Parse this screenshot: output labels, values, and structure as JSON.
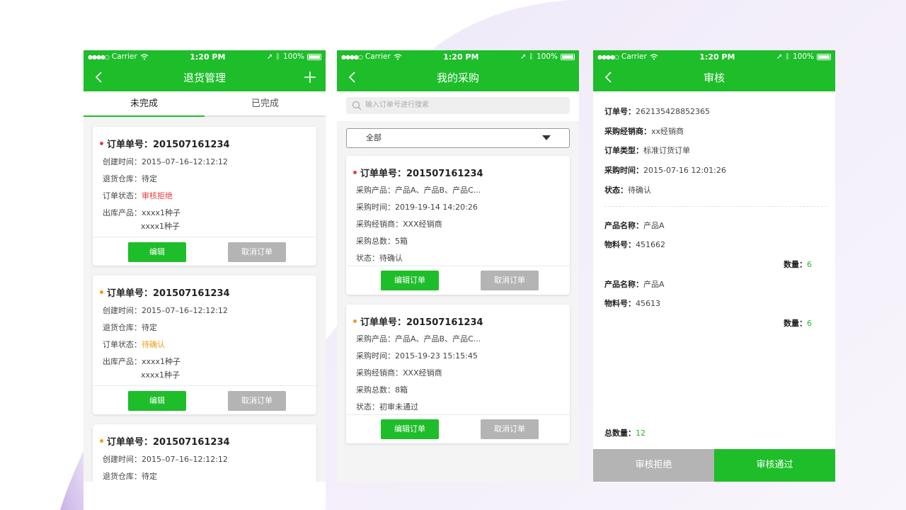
{
  "statusbar": {
    "carrier": "Carrier",
    "time": "1:20 PM",
    "battery": "100%"
  },
  "screen1": {
    "title": "退货管理",
    "tabs": [
      "未完成",
      "已完成"
    ],
    "cards": [
      {
        "dot_color": "#e84040",
        "order_label": "订单单号：",
        "order_no": "201507161234",
        "created_label": "创建时间：",
        "created": "2015–07–16–12:12:12",
        "warehouse_label": "退货仓库：",
        "warehouse": "待定",
        "status_label": "订单状态：",
        "status": "审核拒绝",
        "status_color": "red",
        "products_label": "出库产品：",
        "products": [
          "xxxx1种子",
          "xxxx1种子"
        ],
        "edit": "编辑",
        "cancel": "取消订单"
      },
      {
        "dot_color": "#f59a12",
        "order_label": "订单单号：",
        "order_no": "201507161234",
        "created_label": "创建时间：",
        "created": "2015–07–16–12:12:12",
        "warehouse_label": "退货仓库：",
        "warehouse": "待定",
        "status_label": "订单状态：",
        "status": "待确认",
        "status_color": "orange",
        "products_label": "出库产品：",
        "products": [
          "xxxx1种子",
          "xxxx1种子"
        ],
        "edit": "编辑",
        "cancel": "取消订单"
      },
      {
        "dot_color": "#f59a12",
        "order_label": "订单单号：",
        "order_no": "201507161234",
        "created_label": "创建时间：",
        "created": "2015–07–16–12:12:12",
        "warehouse_label": "退货仓库：",
        "warehouse": "待定"
      }
    ]
  },
  "screen2": {
    "title": "我的采购",
    "search_placeholder": "输入订单号进行搜索",
    "filter": "全部",
    "cards": [
      {
        "dot_color": "#e84040",
        "order_label": "订单单号：",
        "order_no": "201507161234",
        "products": "采购产品：产品A、产品B、产品C...",
        "time": "采购时间：2019-19-14 14:20:26",
        "dealer": "采购经销商：XXX经销商",
        "total": "采购总数：5箱",
        "status": "状态：待确认",
        "edit": "编辑订单",
        "cancel": "取消订单"
      },
      {
        "dot_color": "#f59a12",
        "order_label": "订单单号：",
        "order_no": "201507161234",
        "products": "采购产品：产品A、产品B、产品C...",
        "time": "采购时间：2015-19-23 15:15:45",
        "dealer": "采购经销商：XXX经销商",
        "total": "采购总数：8箱",
        "status": "状态：初审未通过",
        "edit": "编辑订单",
        "cancel": "取消订单"
      }
    ]
  },
  "screen3": {
    "title": "审核",
    "order_no_label": "订单号：",
    "order_no": "262135428852365",
    "dealer_label": "采购经销商：",
    "dealer": "xx经销商",
    "type_label": "订单类型：",
    "type": "标准订货订单",
    "time_label": "采购时间：",
    "time": "2015-07-16 12:01:26",
    "status_label": "状态：",
    "status": "待确认",
    "items": [
      {
        "name_label": "产品名称：",
        "name": "产品A",
        "code_label": "物料号：",
        "code": "451662",
        "qty_label": "数量：",
        "qty": "6"
      },
      {
        "name_label": "产品名称：",
        "name": "产品A",
        "code_label": "物料号：",
        "code": "45613",
        "qty_label": "数量：",
        "qty": "6"
      }
    ],
    "total_label": "总数量：",
    "total": "12",
    "reject": "审核拒绝",
    "approve": "审核通过"
  }
}
